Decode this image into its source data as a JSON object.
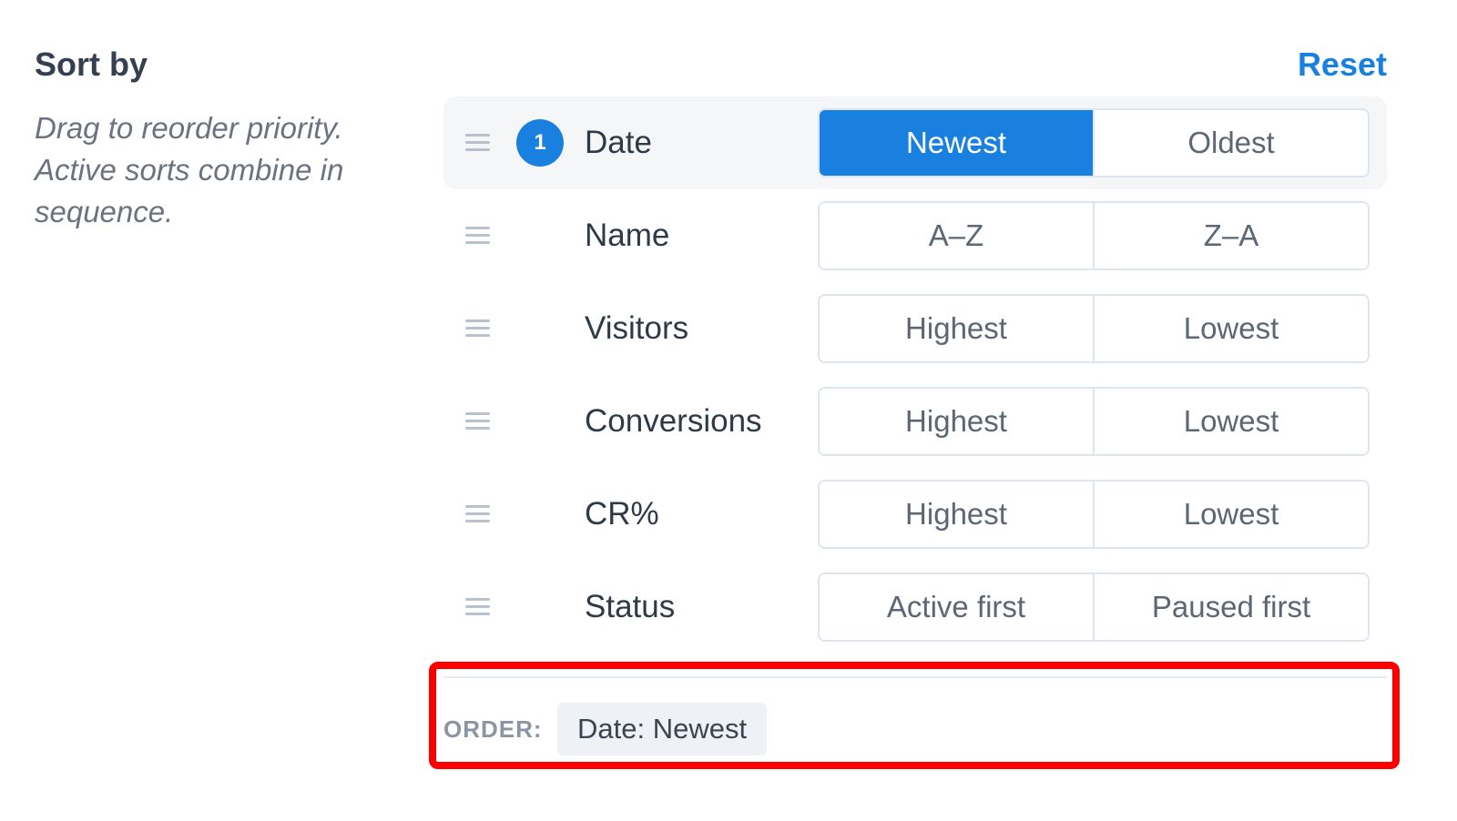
{
  "panel": {
    "title": "Sort by",
    "help_text": "Drag to reorder priority. Active sorts combine in sequence.",
    "reset_label": "Reset"
  },
  "sort_fields": [
    {
      "label": "Date",
      "priority": "1",
      "options": [
        "Newest",
        "Oldest"
      ],
      "selected": "Newest",
      "active": true
    },
    {
      "label": "Name",
      "priority": "",
      "options": [
        "A–Z",
        "Z–A"
      ],
      "selected": "",
      "active": false
    },
    {
      "label": "Visitors",
      "priority": "",
      "options": [
        "Highest",
        "Lowest"
      ],
      "selected": "",
      "active": false
    },
    {
      "label": "Conversions",
      "priority": "",
      "options": [
        "Highest",
        "Lowest"
      ],
      "selected": "",
      "active": false
    },
    {
      "label": "CR%",
      "priority": "",
      "options": [
        "Highest",
        "Lowest"
      ],
      "selected": "",
      "active": false
    },
    {
      "label": "Status",
      "priority": "",
      "options": [
        "Active first",
        "Paused first"
      ],
      "selected": "",
      "active": false
    }
  ],
  "order_summary": {
    "label": "ORDER:",
    "chips": [
      "Date: Newest"
    ]
  },
  "colors": {
    "accent": "#1a80e0",
    "highlight_box": "#ff0000"
  },
  "icons": {
    "drag_handle": "drag-handle-icon"
  }
}
